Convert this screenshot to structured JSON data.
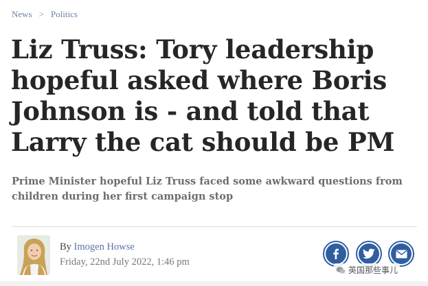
{
  "breadcrumb": {
    "items": [
      "News",
      "Politics"
    ],
    "separator": ">"
  },
  "article": {
    "headline": "Liz Truss: Tory leadership hopeful asked where Boris Johnson is - and told that Larry the cat should be PM",
    "standfirst": "Prime Minister hopeful Liz Truss faced some awkward questions from children during her first campaign stop",
    "byline_prefix": "By",
    "author": "Imogen Howse",
    "date": "Friday, 22nd July 2022, 1:46 pm"
  },
  "share": {
    "buttons": [
      {
        "name": "facebook",
        "icon": "facebook-icon"
      },
      {
        "name": "twitter",
        "icon": "twitter-icon"
      },
      {
        "name": "email",
        "icon": "email-icon"
      }
    ]
  },
  "watermark": {
    "text": "英国那些事儿"
  },
  "colors": {
    "link": "#5a73a8",
    "share_blue": "#2f5fa0",
    "headline": "#262626",
    "standfirst": "#6d6d6d"
  }
}
